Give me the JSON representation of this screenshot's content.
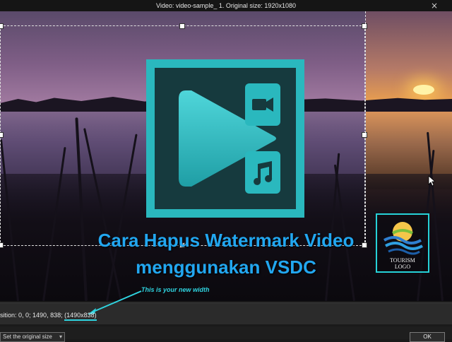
{
  "window": {
    "title": "Video: video-sample_ 1. Original size: 1920x1080",
    "close_glyph": "×"
  },
  "overlay": {
    "title_line1": "Cara Hapus  Watermark Video",
    "title_line2": "menggunakan VSDC",
    "title_color": "#22a7f0",
    "logo_colors": {
      "teal": "#2ab8be",
      "dark": "#163a3e"
    }
  },
  "tourism_logo": {
    "text_line1": "TOURISM",
    "text_line2": "LOGO",
    "border_color": "#26d2d8"
  },
  "annotation": {
    "hint": "This is your new width"
  },
  "statusbar": {
    "position_label": "sition:",
    "position_value": "0, 0; 1490, 838;",
    "size_value": "(1490x838)"
  },
  "bottombar": {
    "combo_label": "Set the original size",
    "ok_label": "OK"
  },
  "icons": [
    "close-icon",
    "play-icon",
    "camera-icon",
    "music-note-icon",
    "chevron-down-icon",
    "mouse-cursor-icon",
    "sun-wave-logo-icon"
  ]
}
